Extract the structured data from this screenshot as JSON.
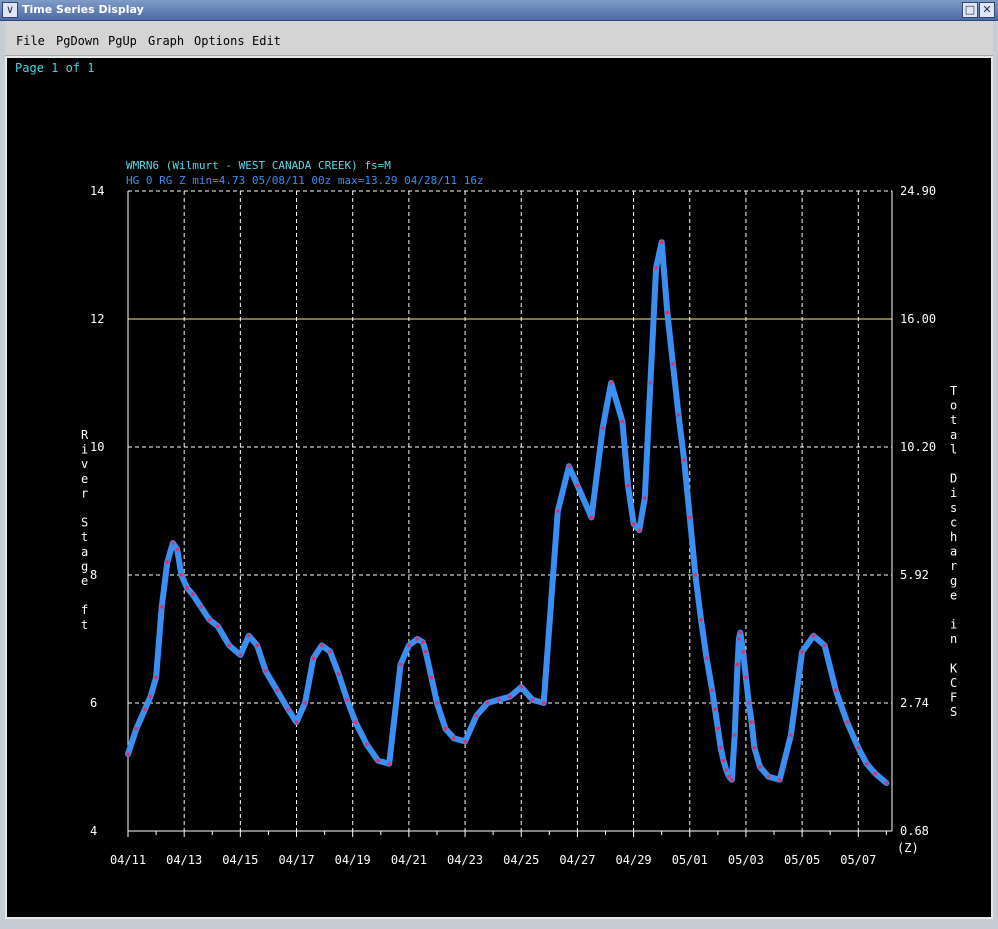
{
  "window": {
    "title": "Time Series Display",
    "menu": [
      "File",
      "PgDown",
      "PgUp",
      "Graph",
      "Options",
      "Edit"
    ]
  },
  "page_indicator": "Page 1 of 1",
  "colors": {
    "background": "#000000",
    "grid": "#ffffff",
    "threshold": "#f0f080",
    "series": "#3a8ff0",
    "points": "#e0306a",
    "header_line1": "#58d8e8",
    "header_line2": "#3a8ff0",
    "page_text": "#3ad8e8"
  },
  "chart_data": {
    "type": "line",
    "header_line1": "WMRN6 (Wilmurt - WEST CANADA CREEK) fs=M",
    "header_line2": "HG 0 RG Z min=4.73 05/08/11 00z max=13.29 04/28/11 16z",
    "ylabel": "River Stage ft",
    "ylabel_right": "Total Discharge in KCFS",
    "ylim": [
      4,
      14
    ],
    "yticks": [
      "4",
      "6",
      "8",
      "10",
      "12",
      "14"
    ],
    "yticks_right": [
      "0.68",
      "2.74",
      "5.92",
      "10.20",
      "16.00",
      "24.90"
    ],
    "xticks": [
      "04/11",
      "04/13",
      "04/15",
      "04/17",
      "04/19",
      "04/21",
      "04/23",
      "04/25",
      "04/27",
      "04/29",
      "05/01",
      "05/03",
      "05/05",
      "05/07"
    ],
    "xlim": [
      0,
      27.2
    ],
    "x_unit_label": "(Z)",
    "threshold": {
      "value": 12
    },
    "series": [
      {
        "x": [
          0,
          0.3,
          0.6,
          0.8,
          1.0,
          1.2,
          1.4,
          1.6,
          1.75,
          1.9,
          2.1,
          2.3,
          2.6,
          2.9,
          3.2,
          3.6,
          4.0,
          4.3,
          4.6,
          4.9,
          5.3,
          5.7,
          6.0,
          6.3,
          6.6,
          6.9,
          7.2,
          7.5,
          7.8,
          8.1,
          8.5,
          8.9,
          9.3,
          9.7,
          10.0,
          10.3,
          10.5,
          10.6,
          10.8,
          11.0,
          11.3,
          11.6,
          12.0,
          12.4,
          12.8,
          13.2,
          13.6,
          14.0,
          14.4,
          14.8,
          15.3,
          15.7,
          16.0,
          16.5,
          16.9,
          17.2,
          17.6,
          17.8,
          18.0,
          18.2,
          18.4,
          18.6,
          18.8,
          19.0,
          19.2,
          19.4,
          19.6,
          19.8,
          20.0,
          20.2,
          20.4,
          20.6,
          20.8,
          20.9,
          21.0,
          21.1,
          21.2,
          21.3,
          21.4,
          21.5,
          21.6,
          21.7,
          21.75,
          21.8,
          21.9,
          22.0,
          22.1,
          22.2,
          22.3,
          22.5,
          22.8,
          23.2,
          23.6,
          24.0,
          24.4,
          24.8,
          25.2,
          25.6,
          26.0,
          26.3,
          26.6,
          27.0
        ],
        "y": [
          5.2,
          5.6,
          5.9,
          6.1,
          6.4,
          7.5,
          8.2,
          8.5,
          8.4,
          8.0,
          7.8,
          7.7,
          7.5,
          7.3,
          7.2,
          6.9,
          6.75,
          7.05,
          6.9,
          6.5,
          6.2,
          5.9,
          5.7,
          6.0,
          6.7,
          6.9,
          6.8,
          6.45,
          6.05,
          5.7,
          5.35,
          5.1,
          5.05,
          6.6,
          6.9,
          7.0,
          6.95,
          6.8,
          6.4,
          6.0,
          5.6,
          5.45,
          5.4,
          5.8,
          6.0,
          6.05,
          6.1,
          6.25,
          6.05,
          6.0,
          9.0,
          9.7,
          9.4,
          8.9,
          10.3,
          11.0,
          10.4,
          9.4,
          8.8,
          8.7,
          9.2,
          11.0,
          12.8,
          13.2,
          12.1,
          11.3,
          10.5,
          9.8,
          8.9,
          8.0,
          7.3,
          6.7,
          6.2,
          5.9,
          5.6,
          5.3,
          5.1,
          4.95,
          4.85,
          4.8,
          5.5,
          6.6,
          7.0,
          7.1,
          6.8,
          6.4,
          6.0,
          5.7,
          5.3,
          5.0,
          4.85,
          4.8,
          5.5,
          6.8,
          7.05,
          6.9,
          6.2,
          5.7,
          5.3,
          5.05,
          4.9,
          4.75
        ]
      }
    ]
  }
}
